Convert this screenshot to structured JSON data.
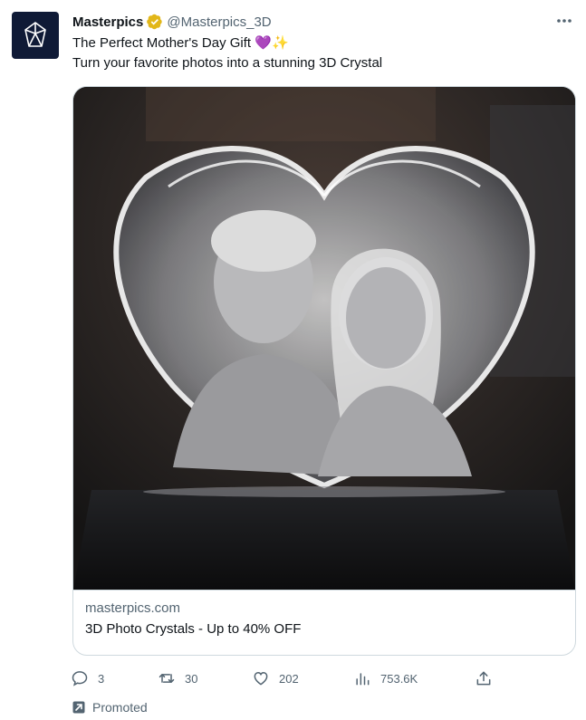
{
  "author": {
    "name": "Masterpics",
    "handle": "@Masterpics_3D",
    "verified_badge_icon": "gold-verified-badge-icon",
    "avatar_icon": "crystal-gem-logo",
    "avatar_color": "#0f1a36"
  },
  "tweet": {
    "line1": "The Perfect Mother's Day Gift 💜✨",
    "line2": "Turn your favorite photos into a stunning 3D Crystal"
  },
  "card": {
    "image_description_icon": "heart-crystal-photo",
    "domain": "masterpics.com",
    "title": "3D Photo Crystals - Up to 40% OFF"
  },
  "actions": {
    "replies": "3",
    "retweets": "30",
    "likes": "202",
    "views": "753.6K"
  },
  "promoted": {
    "label": "Promoted",
    "icon": "promoted-arrow-icon"
  },
  "colors": {
    "text_primary": "#0f1419",
    "text_secondary": "#536471",
    "border": "#cfd9de",
    "badge_gold": "#e2b719"
  }
}
